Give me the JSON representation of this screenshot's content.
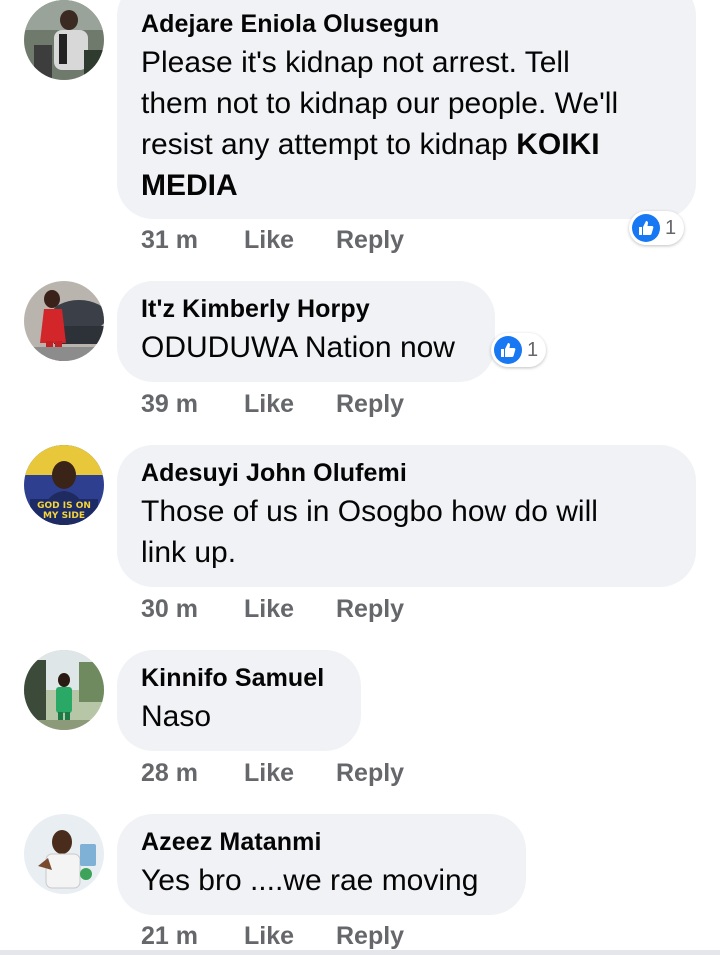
{
  "comments": [
    {
      "author": "Adejare Eniola Olusegun",
      "lines": [
        "Please it's kidnap not arrest. Tell",
        "them not to kidnap our people. We'll",
        "resist any attempt to kidnap "
      ],
      "bold_tail": "KOIKI",
      "bold_line": "MEDIA",
      "time": "31 m",
      "like": "Like",
      "reply": "Reply",
      "reactions": "1"
    },
    {
      "author": "It'z Kimberly Horpy",
      "lines": [
        "ODUDUWA Nation now"
      ],
      "time": "39 m",
      "like": "Like",
      "reply": "Reply",
      "reactions": "1"
    },
    {
      "author": "Adesuyi John Olufemi",
      "lines": [
        "Those of us in Osogbo how do will",
        "link up."
      ],
      "avatar_text": [
        "GOD IS ON",
        "MY SIDE"
      ],
      "time": "30 m",
      "like": "Like",
      "reply": "Reply"
    },
    {
      "author": "Kinnifo Samuel",
      "lines": [
        "Naso"
      ],
      "time": "28 m",
      "like": "Like",
      "reply": "Reply"
    },
    {
      "author": "Azeez Matanmi",
      "lines": [
        "Yes bro ....we rae moving"
      ],
      "time": "21 m",
      "like": "Like",
      "reply": "Reply"
    }
  ],
  "colors": {
    "bubble": "#f0f2f5",
    "meta": "#65676b",
    "like_blue": "#1877f2"
  }
}
